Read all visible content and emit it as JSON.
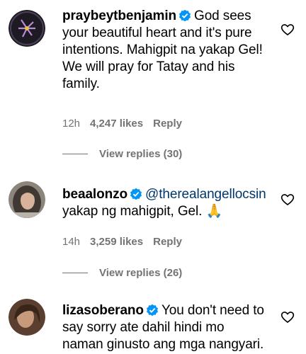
{
  "comments": [
    {
      "username": "praybeytbenjamin",
      "text": "God sees your beautiful heart and it's pure intentions. Mahigpit na yakap Gel! We will pray for Tatay and his family.",
      "time": "12h",
      "likes": "4,247 likes",
      "reply": "Reply",
      "view_replies": "View replies (30)"
    },
    {
      "username": "beaalonzo",
      "mention": "@therealangellocsin",
      "text": "yakap ng mahigpit, Gel. 🙏",
      "time": "14h",
      "likes": "3,259 likes",
      "reply": "Reply",
      "view_replies": "View replies (26)"
    },
    {
      "username": "lizasoberano",
      "text": "You don't need to say sorry ate dahil hindi mo naman ginusto ang mga nangyari."
    }
  ],
  "colors": {
    "verified": "#0095f6",
    "meta": "#737373",
    "mention": "#00376b"
  }
}
